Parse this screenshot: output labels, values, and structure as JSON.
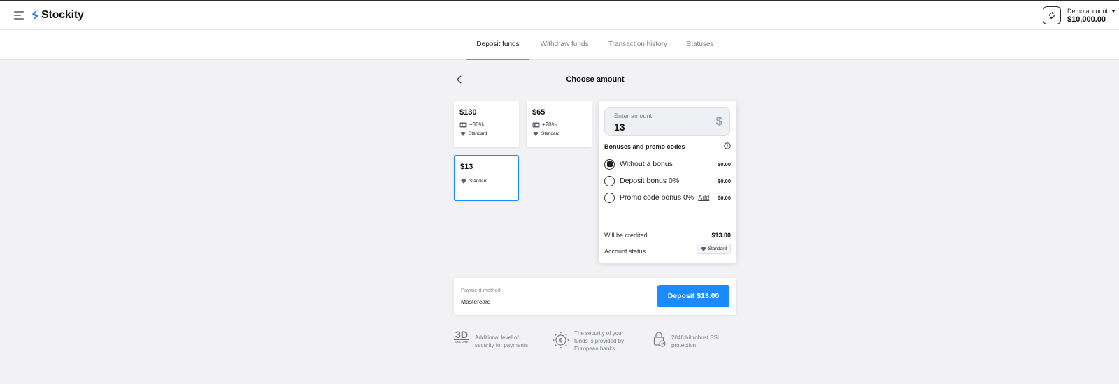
{
  "header": {
    "logo_text": "Stockity",
    "account_label": "Demo account",
    "account_balance": "$10,000.00"
  },
  "tabs": [
    "Deposit funds",
    "Withdraw funds",
    "Transaction history",
    "Statuses"
  ],
  "page_title": "Choose amount",
  "cards": [
    {
      "amount": "$130",
      "bonus": "+30%",
      "status": "Standard"
    },
    {
      "amount": "$65",
      "bonus": "+20%",
      "status": "Standard"
    },
    {
      "amount": "$13",
      "bonus": "",
      "status": "Standard"
    }
  ],
  "amount_input": {
    "placeholder": "Enter amount",
    "value": "13",
    "currency": "$"
  },
  "bonuses": {
    "title": "Bonuses and promo codes",
    "options": [
      {
        "label": "Without a bonus",
        "value": "$0.00"
      },
      {
        "label": "Deposit bonus 0%",
        "value": "$0.00"
      },
      {
        "label": "Promo code bonus 0%",
        "add": "Add",
        "value": "$0.00"
      }
    ]
  },
  "credited": {
    "label": "Will be credited",
    "value": "$13.00"
  },
  "account_status": {
    "label": "Account status",
    "value": "Standard"
  },
  "payment": {
    "label": "Payment method",
    "value": "Mastercard",
    "button": "Deposit $13.00"
  },
  "features": {
    "f1_badge": "3D",
    "f1_badge_sub": "SECURE",
    "f1_line1": "Additional level of",
    "f1_line2": "security for payments",
    "f2_line1": "The security of your",
    "f2_line2": "funds is provided by",
    "f2_line3": "European banks",
    "f3_line1": "2048 bit robust SSL",
    "f3_line2": "protection"
  },
  "colors": {
    "accent": "#1a8cff",
    "brand": "#1a7cf5",
    "background": "#f2f2f5"
  }
}
